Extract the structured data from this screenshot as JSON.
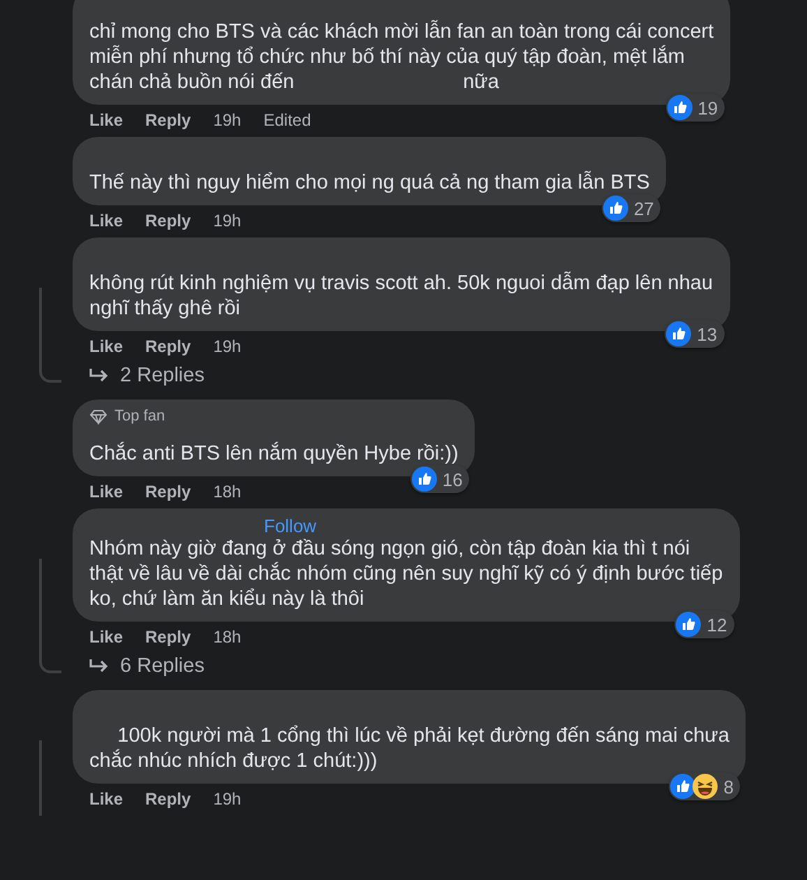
{
  "comments": [
    {
      "text": "chỉ mong cho BTS và các khách mời lẫn fan an toàn trong cái concert\nmiễn phí nhưng tổ chức như bố thí này của quý tập đoàn, mệt lắm\nchán chả buồn nói đến                              nữa",
      "reactions": [
        {
          "kind": "like"
        }
      ],
      "reaction_count": "19",
      "actions": [
        "Like",
        "Reply"
      ],
      "time": "19h",
      "edited": "Edited",
      "thread": false
    },
    {
      "text": "Thế này thì nguy hiểm cho mọi ng quá cả ng tham gia lẫn BTS",
      "reactions": [
        {
          "kind": "like"
        }
      ],
      "reaction_count": "27",
      "actions": [
        "Like",
        "Reply"
      ],
      "time": "19h",
      "thread": false
    },
    {
      "text": "không rút kinh nghiệm vụ travis scott ah. 50k nguoi dẫm đạp lên nhau\nnghĩ thấy ghê rồi",
      "reactions": [
        {
          "kind": "like"
        }
      ],
      "reaction_count": "13",
      "actions": [
        "Like",
        "Reply"
      ],
      "time": "19h",
      "thread": true,
      "replies": "2 Replies"
    },
    {
      "badge": "Top fan",
      "text": "Chắc anti BTS lên nắm quyền Hybe rồi:))",
      "reactions": [
        {
          "kind": "like"
        }
      ],
      "reaction_count": "16",
      "actions": [
        "Like",
        "Reply"
      ],
      "time": "18h",
      "thread": false
    },
    {
      "follow": "Follow",
      "text": "Nhóm này giờ đang ở đầu sóng ngọn gió, còn tập đoàn kia thì t nói\nthật về lâu về dài chắc nhóm cũng nên suy nghĩ kỹ có ý định bước tiếp\nko, chứ làm ăn kiểu này là thôi",
      "reactions": [
        {
          "kind": "like"
        }
      ],
      "reaction_count": "12",
      "actions": [
        "Like",
        "Reply"
      ],
      "time": "18h",
      "thread": true,
      "replies": "6 Replies"
    },
    {
      "text": "     100k người mà 1 cổng thì lúc về phải kẹt đường đến sáng mai chưa\nchắc nhúc nhích được 1 chút:)))",
      "reactions": [
        {
          "kind": "like"
        },
        {
          "kind": "haha"
        }
      ],
      "reaction_count": "8",
      "actions": [
        "Like",
        "Reply"
      ],
      "time": "19h",
      "thread": true
    }
  ]
}
